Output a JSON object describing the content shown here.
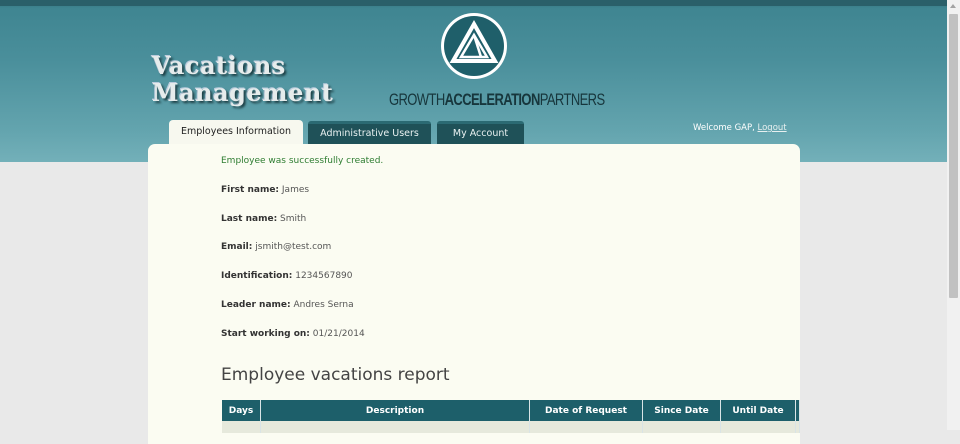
{
  "header": {
    "app_title_line1": "Vacations",
    "app_title_line2": "Management",
    "company_part1": "GROWTH",
    "company_part2": "ACCELERATION",
    "company_part3": "PARTNERS",
    "logo_icon": "triangle-logo-icon"
  },
  "tabs": [
    {
      "label": "Employees Information",
      "active": true
    },
    {
      "label": "Administrative Users",
      "active": false
    },
    {
      "label": "My Account",
      "active": false
    }
  ],
  "user": {
    "welcome": "Welcome GAP,",
    "logout": "Logout"
  },
  "employee": {
    "success_message": "Employee was successfully created.",
    "first_name_label": "First name:",
    "first_name": "James",
    "last_name_label": "Last name:",
    "last_name": "Smith",
    "email_label": "Email:",
    "email": "jsmith@test.com",
    "identification_label": "Identification:",
    "identification": "1234567890",
    "leader_label": "Leader name:",
    "leader": "Andres Serna",
    "start_label": "Start working on:",
    "start": "01/21/2014"
  },
  "report": {
    "title": "Employee vacations report",
    "columns": [
      "Days",
      "Description",
      "Date of Request",
      "Since Date",
      "Until Date"
    ]
  },
  "colors": {
    "header_teal": "#4a8f9b",
    "tab_dark": "#1f5158",
    "table_header": "#1d5f6a",
    "success_green": "#2e7d32"
  }
}
